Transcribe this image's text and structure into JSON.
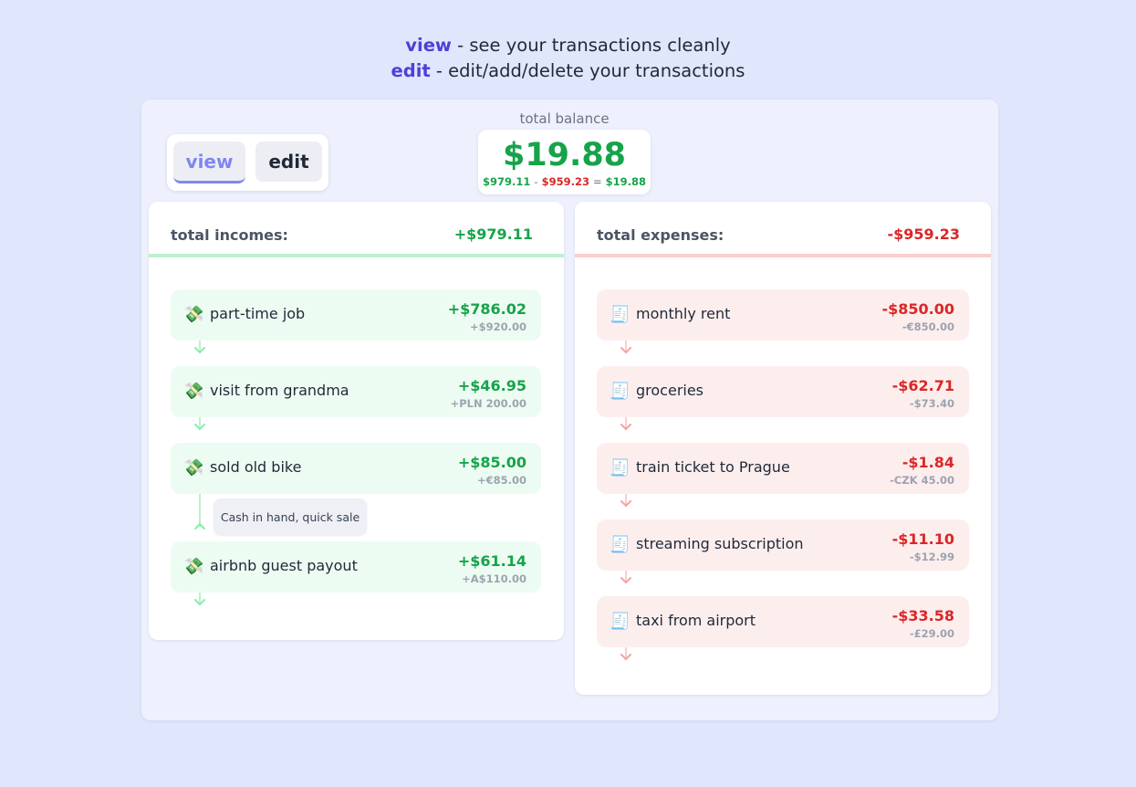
{
  "intro": {
    "view_kw": "view",
    "view_text": " - see your transactions cleanly",
    "edit_kw": "edit",
    "edit_text": " - edit/add/delete your transactions"
  },
  "mode": {
    "view_label": "view",
    "edit_label": "edit",
    "active": "view"
  },
  "balance": {
    "label": "total balance",
    "amount": "$19.88",
    "income": "$979.11",
    "minus": "-",
    "expense": "$959.23",
    "equals": "=",
    "result": "$19.88"
  },
  "incomes": {
    "title": "total incomes:",
    "total": "+$979.11",
    "icon": "money-with-wings-icon",
    "items": [
      {
        "name": "part-time job",
        "amount": "+$786.02",
        "original": "+$920.00"
      },
      {
        "name": "visit from grandma",
        "amount": "+$46.95",
        "original": "+PLN 200.00"
      },
      {
        "name": "sold old bike",
        "amount": "+$85.00",
        "original": "+€85.00",
        "note": "Cash in hand, quick sale"
      },
      {
        "name": "airbnb guest payout",
        "amount": "+$61.14",
        "original": "+A$110.00"
      }
    ]
  },
  "expenses": {
    "title": "total expenses:",
    "total": "-$959.23",
    "icon": "receipt-icon",
    "items": [
      {
        "name": "monthly rent",
        "amount": "-$850.00",
        "original": "-€850.00"
      },
      {
        "name": "groceries",
        "amount": "-$62.71",
        "original": "-$73.40"
      },
      {
        "name": "train ticket to Prague",
        "amount": "-$1.84",
        "original": "-CZK 45.00"
      },
      {
        "name": "streaming subscription",
        "amount": "-$11.10",
        "original": "-$12.99"
      },
      {
        "name": "taxi from airport",
        "amount": "-$33.58",
        "original": "-£29.00"
      }
    ]
  },
  "colors": {
    "income": "#16a34a",
    "expense": "#dc2626",
    "accent": "#4f3ed8",
    "background": "#e0e6fc"
  }
}
